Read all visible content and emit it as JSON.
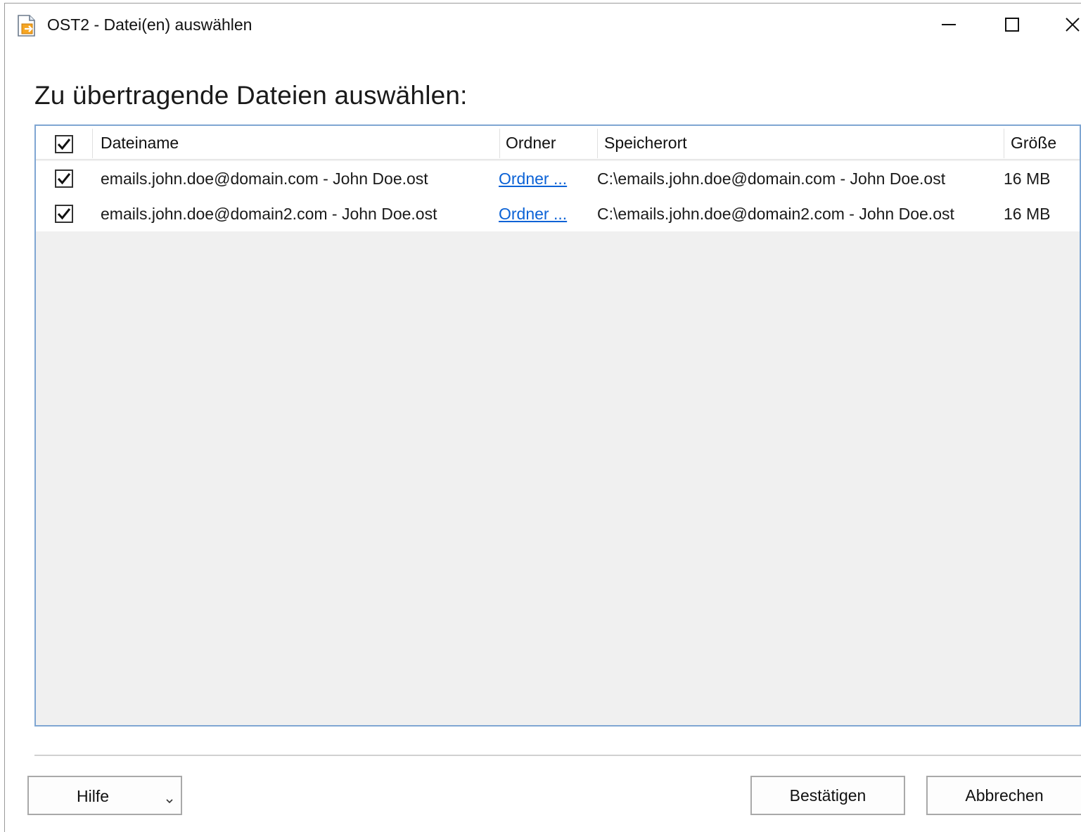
{
  "window": {
    "title": "OST2 - Datei(en) auswählen",
    "controls": {
      "minimize": "minimize",
      "maximize": "maximize",
      "close": "close"
    }
  },
  "heading": "Zu übertragende Dateien auswählen:",
  "table": {
    "select_all_checked": true,
    "columns": {
      "filename": "Dateiname",
      "folder": "Ordner",
      "location": "Speicherort",
      "size": "Größe"
    },
    "rows": [
      {
        "checked": true,
        "filename": "emails.john.doe@domain.com - John Doe.ost",
        "folder_link": "Ordner ...",
        "location": "C:\\emails.john.doe@domain.com - John Doe.ost",
        "size": "16 MB"
      },
      {
        "checked": true,
        "filename": "emails.john.doe@domain2.com - John Doe.ost",
        "folder_link": "Ordner ...",
        "location": "C:\\emails.john.doe@domain2.com - John Doe.ost",
        "size": "16 MB"
      }
    ]
  },
  "buttons": {
    "help": "Hilfe",
    "confirm": "Bestätigen",
    "cancel": "Abbrechen"
  },
  "colors": {
    "link": "#0b62d6",
    "list_border": "#7fa6d2",
    "list_background": "#f0f0f0"
  }
}
